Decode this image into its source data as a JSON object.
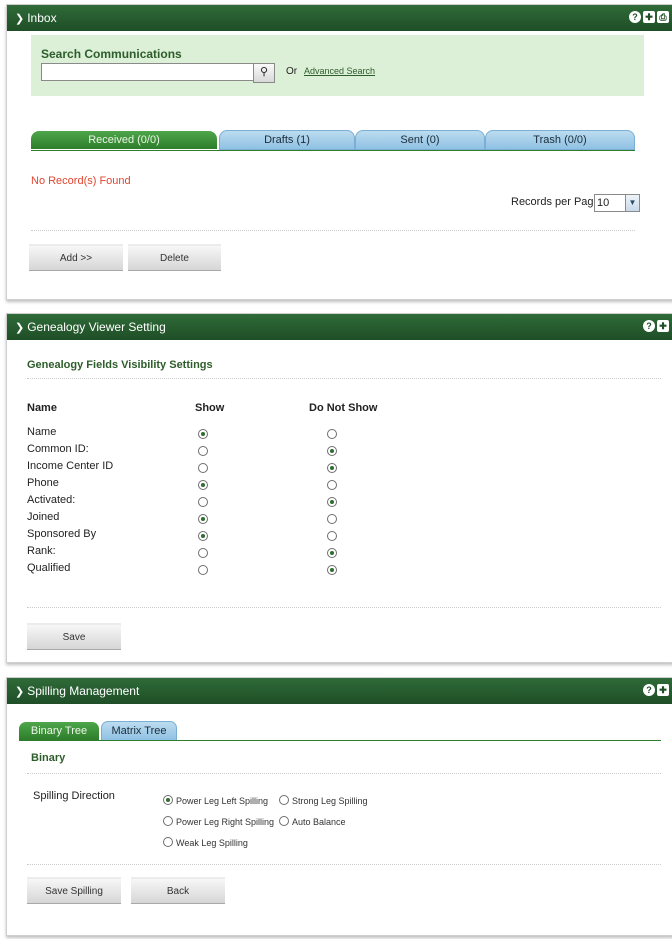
{
  "inbox": {
    "title": "Inbox",
    "search": {
      "label": "Search Communications",
      "value": "",
      "placeholder": "",
      "or_text": "Or",
      "advanced_link": "Advanced Search"
    },
    "tabs": [
      {
        "label": "Received (0/0)",
        "active": true
      },
      {
        "label": "Drafts (1)",
        "active": false
      },
      {
        "label": "Sent (0)",
        "active": false
      },
      {
        "label": "Trash (0/0)",
        "active": false
      }
    ],
    "no_records": "No Record(s) Found",
    "records_per_page_label": "Records per Page",
    "records_per_page_value": "10",
    "buttons": {
      "add": "Add >>",
      "delete": "Delete"
    }
  },
  "genealogy": {
    "title": "Genealogy Viewer Setting",
    "section_title": "Genealogy Fields Visibility Settings",
    "columns": {
      "name": "Name",
      "show": "Show",
      "do_not_show": "Do Not Show"
    },
    "fields": [
      {
        "name": "Name",
        "show": true
      },
      {
        "name": "Common ID:",
        "show": false
      },
      {
        "name": "Income Center ID",
        "show": false
      },
      {
        "name": "Phone",
        "show": true
      },
      {
        "name": "Activated:",
        "show": false
      },
      {
        "name": "Joined",
        "show": true
      },
      {
        "name": "Sponsored By",
        "show": true
      },
      {
        "name": "Rank:",
        "show": false
      },
      {
        "name": "Qualified",
        "show": false
      }
    ],
    "buttons": {
      "save": "Save"
    }
  },
  "spilling": {
    "title": "Spilling Management",
    "tabs": [
      {
        "label": "Binary Tree",
        "active": true
      },
      {
        "label": "Matrix Tree",
        "active": false
      }
    ],
    "section_title": "Binary",
    "direction_label": "Spilling Direction",
    "options": [
      {
        "label": "Power Leg Left Spilling",
        "selected": true
      },
      {
        "label": "Strong Leg Spilling",
        "selected": false
      },
      {
        "label": "Power Leg Right Spilling",
        "selected": false
      },
      {
        "label": "Auto Balance",
        "selected": false
      },
      {
        "label": "Weak Leg Spilling",
        "selected": false
      }
    ],
    "buttons": {
      "save": "Save Spilling",
      "back": "Back"
    }
  },
  "header_icons": [
    "help-icon",
    "settings-icon",
    "print-icon"
  ],
  "colors": {
    "header": "#1f4e27",
    "active_tab": "#2d7d2b",
    "inactive_tab": "#a9cfea",
    "search_bg": "#dcefd7",
    "warning": "#e0452f"
  }
}
